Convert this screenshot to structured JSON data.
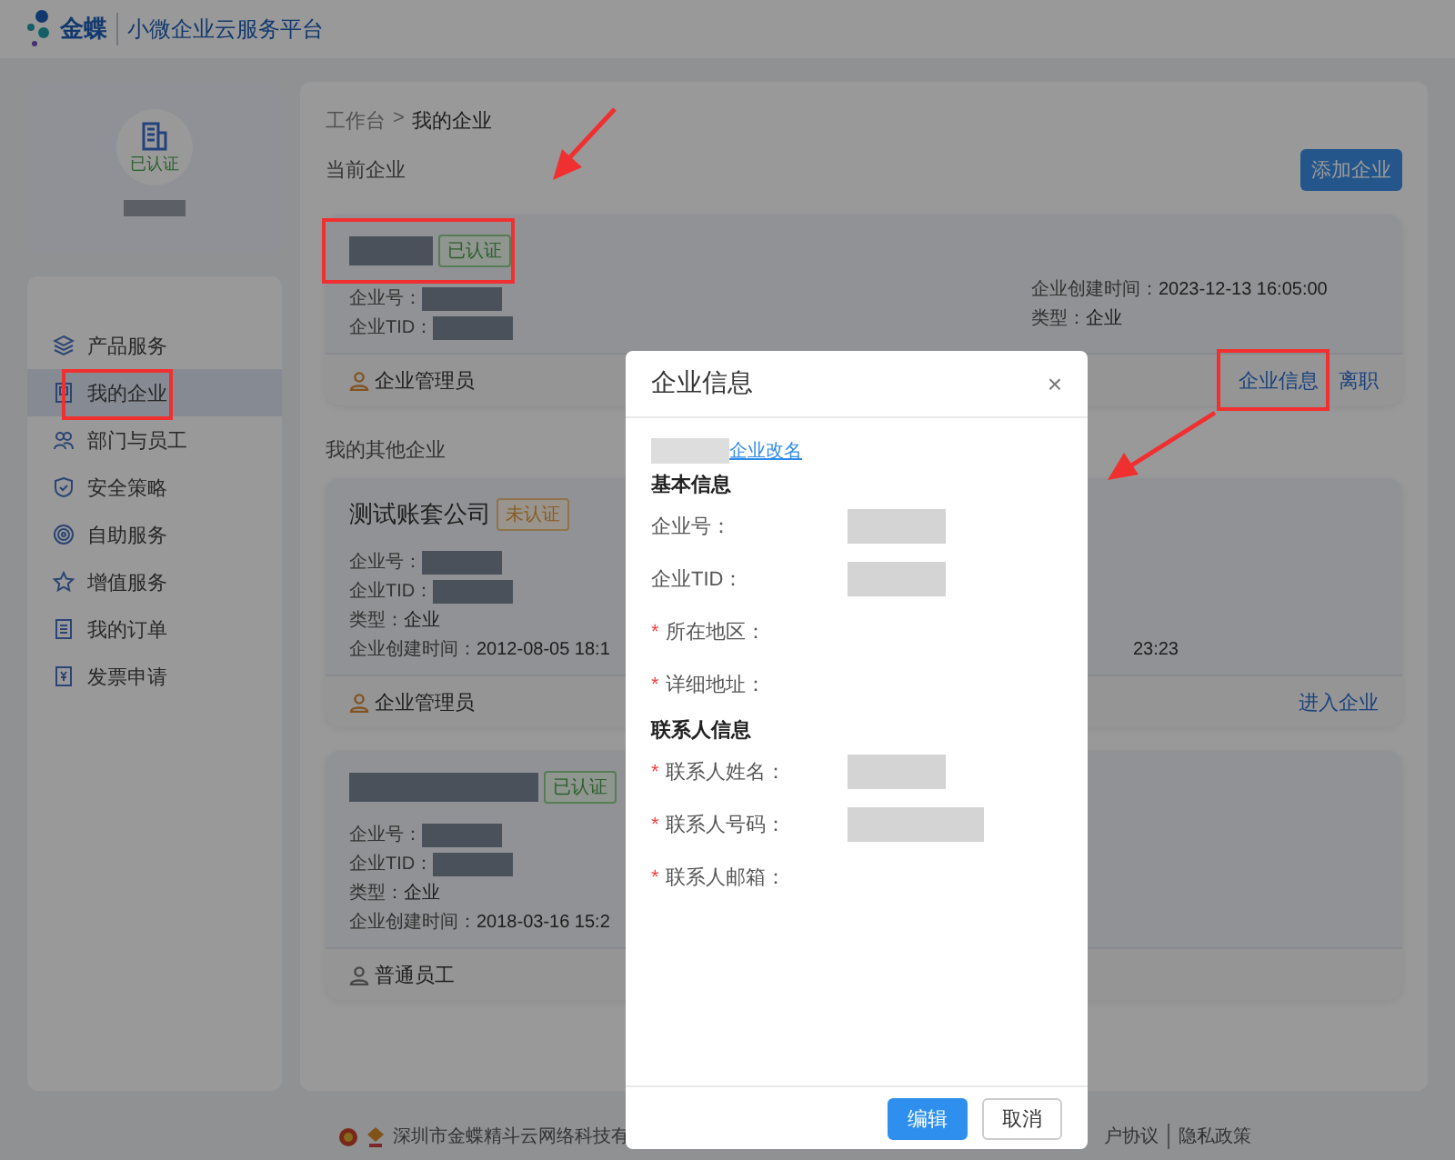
{
  "header": {
    "brand": "金蝶",
    "product": "小微企业云服务平台"
  },
  "profile": {
    "status": "已认证"
  },
  "nav": [
    {
      "label": "产品服务",
      "selected": false
    },
    {
      "label": "我的企业",
      "selected": true
    },
    {
      "label": "部门与员工",
      "selected": false
    },
    {
      "label": "安全策略",
      "selected": false
    },
    {
      "label": "自助服务",
      "selected": false
    },
    {
      "label": "增值服务",
      "selected": false
    },
    {
      "label": "我的订单",
      "selected": false
    },
    {
      "label": "发票申请",
      "selected": false
    }
  ],
  "breadcrumb": {
    "items": [
      "工作台",
      "我的企业"
    ],
    "separator": ">"
  },
  "current_section": {
    "title": "当前企业",
    "add_button": "添加企业"
  },
  "current_company": {
    "badge": {
      "label": "已认证",
      "verified": true
    },
    "fields_left": [
      {
        "label": "企业号：",
        "redacted": true
      },
      {
        "label": "企业TID：",
        "redacted": true
      }
    ],
    "fields_right": [
      {
        "label": "企业创建时间：",
        "value": "2023-12-13 16:05:00"
      },
      {
        "label": "类型：",
        "value": "企业"
      }
    ],
    "role": {
      "label": "企业管理员",
      "kind": "admin"
    },
    "actions": [
      "企业信息",
      "离职"
    ]
  },
  "other_section": "我的其他企业",
  "other_companies": [
    {
      "name": "测试账套公司",
      "badge": {
        "label": "未认证",
        "verified": false
      },
      "fields": [
        {
          "label": "企业号：",
          "redacted": true
        },
        {
          "label": "企业TID：",
          "redacted": true
        },
        {
          "label": "类型：",
          "value": "企业"
        },
        {
          "label": "企业创建时间：",
          "value": "2012-08-05 18:1"
        }
      ],
      "extra": "23:23",
      "role": {
        "label": "企业管理员",
        "kind": "admin"
      },
      "action": "进入企业"
    },
    {
      "badge": {
        "label": "已认证",
        "verified": true
      },
      "fields": [
        {
          "label": "企业号：",
          "redacted": true
        },
        {
          "label": "企业TID：",
          "redacted": true
        },
        {
          "label": "类型：",
          "value": "企业"
        },
        {
          "label": "企业创建时间：",
          "value": "2018-03-16 15:2"
        }
      ],
      "role": {
        "label": "普通员工",
        "kind": "member"
      }
    }
  ],
  "footer": {
    "company": "深圳市金蝶精斗云网络科技有",
    "links": [
      "户协议",
      "隐私政策"
    ]
  },
  "modal": {
    "title": "企业信息",
    "close": "×",
    "rename_link": "企业改名",
    "required_mark": "*",
    "sections": [
      {
        "title": "基本信息",
        "fields": [
          {
            "label": "企业号：",
            "required": false,
            "redacted": true
          },
          {
            "label": "企业TID：",
            "required": false,
            "redacted": true
          },
          {
            "label": "所在地区：",
            "required": true,
            "redacted": false
          },
          {
            "label": "详细地址：",
            "required": true,
            "redacted": false
          }
        ]
      },
      {
        "title": "联系人信息",
        "fields": [
          {
            "label": "联系人姓名：",
            "required": true,
            "redacted": true
          },
          {
            "label": "联系人号码：",
            "required": true,
            "redacted": true
          },
          {
            "label": "联系人邮箱：",
            "required": true,
            "redacted": false
          }
        ]
      }
    ],
    "buttons": [
      {
        "label": "编辑",
        "kind": "primary"
      },
      {
        "label": "取消",
        "kind": "default"
      }
    ]
  }
}
